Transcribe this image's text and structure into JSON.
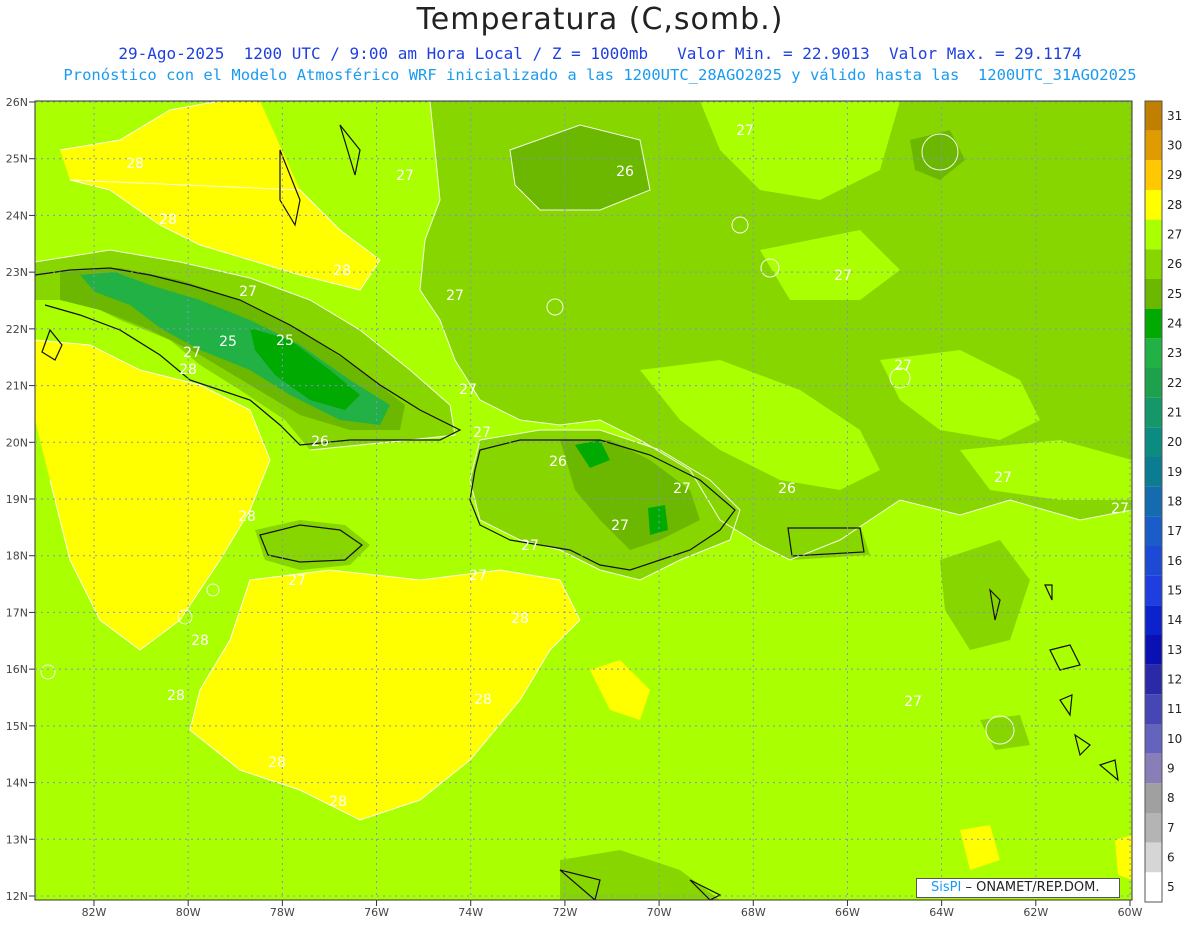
{
  "header": {
    "title": "Temperatura (C,somb.)",
    "line1": "29-Ago-2025  1200 UTC / 9:00 am Hora Local / Z = 1000mb   Valor Min. = 22.9013  Valor Max. = 29.1174",
    "line2": "Pronóstico con el Modelo Atmosférico WRF inicializado a las 1200UTC_28AGO2025 y válido hasta las  1200UTC_31AGO2025"
  },
  "map": {
    "lat_labels": [
      "26N",
      "25N",
      "24N",
      "23N",
      "22N",
      "21N",
      "20N",
      "19N",
      "18N",
      "17N",
      "16N",
      "15N",
      "14N",
      "13N",
      "12N"
    ],
    "lon_labels": [
      "82W",
      "80W",
      "78W",
      "76W",
      "74W",
      "72W",
      "70W",
      "68W",
      "66W",
      "64W",
      "62W",
      "60W"
    ],
    "contour_labels": [
      "27",
      "28",
      "26",
      "27",
      "28",
      "27",
      "25",
      "25",
      "27",
      "28",
      "27",
      "26",
      "27",
      "28",
      "27",
      "26",
      "27",
      "26",
      "27",
      "28",
      "27",
      "27",
      "28",
      "28",
      "28",
      "28",
      "28",
      "28",
      "27",
      "27",
      "27",
      "27",
      "27",
      "27"
    ]
  },
  "colorbar": {
    "levels": [
      "31",
      "30",
      "29",
      "28",
      "27",
      "26",
      "25",
      "24",
      "23",
      "22",
      "21",
      "20",
      "19",
      "18",
      "17",
      "16",
      "15",
      "14",
      "13",
      "12",
      "11",
      "10",
      "9",
      "8",
      "7",
      "6",
      "5"
    ],
    "colors": [
      "#c07f00",
      "#e09b00",
      "#ffc800",
      "#ffff00",
      "#aaff00",
      "#88d600",
      "#6cb800",
      "#00aa00",
      "#22b144",
      "#1ea04c",
      "#14986a",
      "#0c8c80",
      "#0c7c92",
      "#146cae",
      "#1a5cc8",
      "#1c4ad6",
      "#1e3ee0",
      "#0c22cc",
      "#0a10b4",
      "#2a2aa8",
      "#4646b4",
      "#6464be",
      "#8a7eb8",
      "#a0a0a0",
      "#b4b4b4",
      "#d6d6d6",
      "#ffffff"
    ]
  },
  "credit": {
    "logo": "SisPI",
    "org": "– ONAMET/REP.DOM."
  }
}
